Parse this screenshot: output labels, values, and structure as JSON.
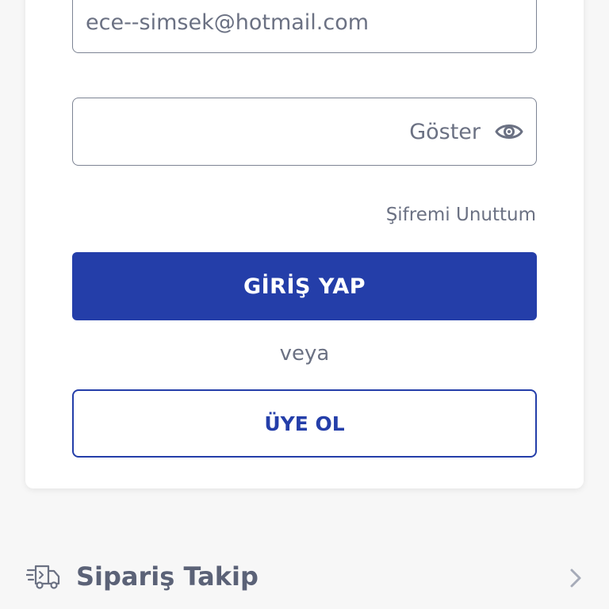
{
  "login_form": {
    "email_value": "ece--simsek@hotmail.com",
    "password_value": "",
    "show_password_label": "Göster",
    "forgot_password_label": "Şifremi Unuttum",
    "login_button_label": "GİRİŞ YAP",
    "or_label": "veya",
    "register_button_label": "ÜYE OL"
  },
  "menu": {
    "order_tracking_label": "Sipariş Takip"
  },
  "icons": {
    "show_password": "eye-icon",
    "order_tracking": "truck-icon",
    "chevron": "chevron-right-icon"
  },
  "colors": {
    "primary": "#243ea9",
    "text_muted": "#6b7183",
    "border": "#7d8494",
    "card_bg": "#ffffff",
    "page_bg": "#f7f7f7"
  }
}
